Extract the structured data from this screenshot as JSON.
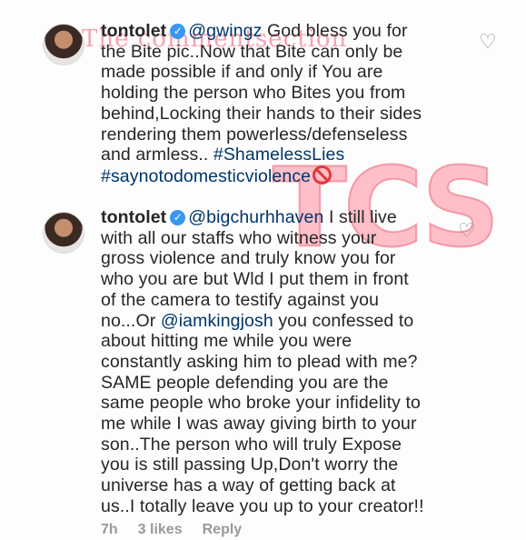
{
  "watermark": {
    "text": "The commentsection",
    "logo": "TCS"
  },
  "comments": [
    {
      "username": "tontolet",
      "lines": [
        [
          "@gwingz",
          " God bless you for"
        ],
        [
          "the Bite pic..Now that Bite can only be"
        ],
        [
          "made possible if and only if You are"
        ],
        [
          "holding the person who Bites you from"
        ],
        [
          "behind,Locking their hands to their sides"
        ],
        [
          "rendering them powerless/defenseless"
        ],
        [
          "and armless.. ",
          "#ShamelessLies"
        ],
        [
          "#saynotodomesticviolence"
        ]
      ],
      "line1_rest": " God bless you for",
      "mention": "@gwingz",
      "line2": "the Bite pic..Now that Bite can only be",
      "line3": "made possible if and only if You are",
      "line4": "holding the person who Bites you from",
      "line5": "behind,Locking their hands to their sides",
      "line6": "rendering them powerless/defenseless",
      "line7_text": "and armless.. ",
      "tag1": "#ShamelessLies",
      "tag2": "#saynotodomesticviolence"
    },
    {
      "username": "tontolet",
      "mention1": "@bigchurhhaven",
      "line1_rest": " I still live",
      "line2": "with all our staffs who witness your",
      "line3": "gross violence and truly know you for",
      "line4": "who you are but Wld I put them in front",
      "line5": "of the camera to testify against you",
      "line6_text": "no...Or ",
      "mention2": "@iamkingjosh",
      "line6_rest": " you confessed to",
      "line7": "about hitting me while you were",
      "line8": "constantly asking him to plead with me?",
      "line9": "SAME people defending you are the",
      "line10": "same people who broke your infidelity to",
      "line11": "me while I was away giving birth to your",
      "line12": "son..The person who will truly Expose",
      "line13": "you is still passing Up,Don't worry the",
      "line14": "universe has a way of getting back at",
      "line15": "us..I totally leave you up to your creator!!",
      "time": "7h",
      "likes": "3 likes",
      "reply": "Reply"
    }
  ],
  "icons": {
    "verified": "verified-badge-icon",
    "like": "heart-outline-icon",
    "prohibited": "no-entry-emoji"
  }
}
